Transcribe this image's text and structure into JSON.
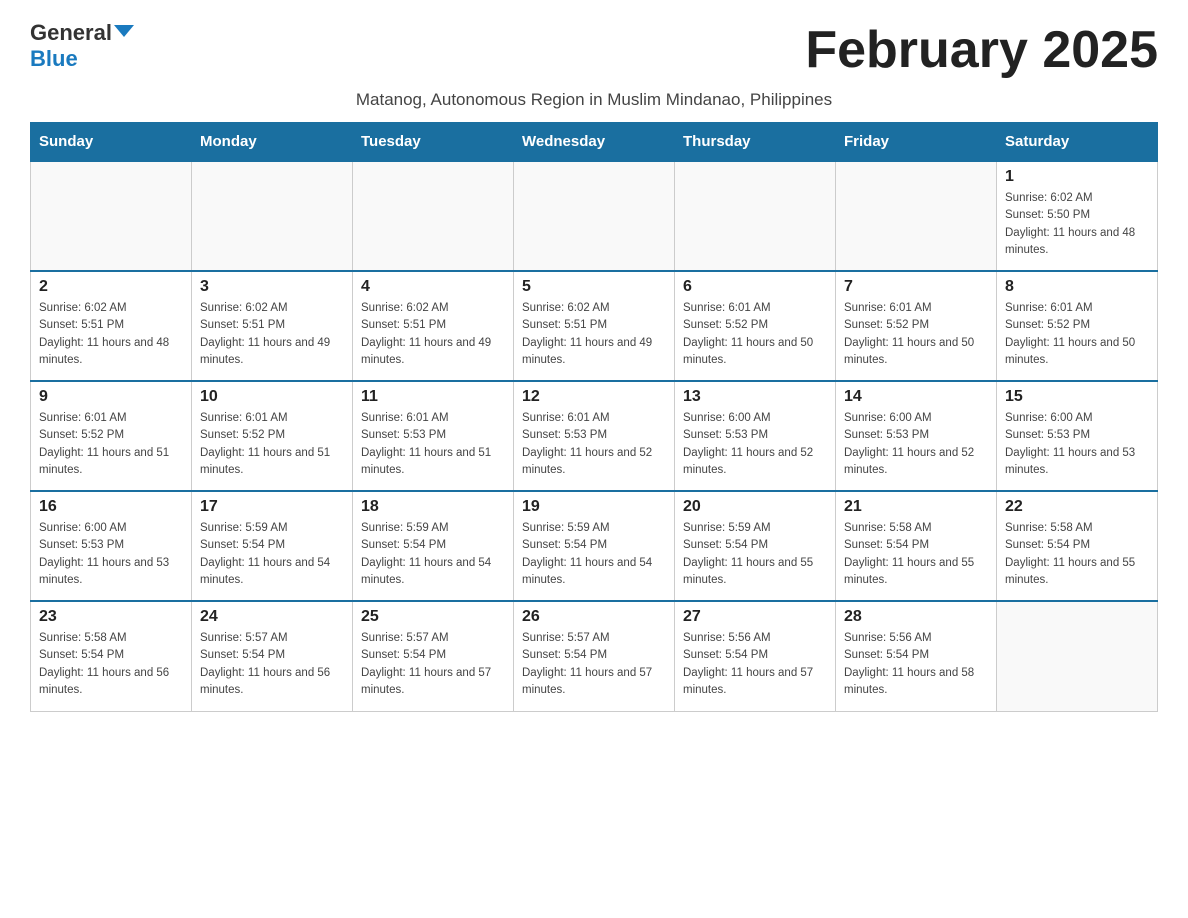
{
  "header": {
    "logo_general": "General",
    "logo_blue": "Blue",
    "month_title": "February 2025",
    "subtitle": "Matanog, Autonomous Region in Muslim Mindanao, Philippines"
  },
  "weekdays": [
    "Sunday",
    "Monday",
    "Tuesday",
    "Wednesday",
    "Thursday",
    "Friday",
    "Saturday"
  ],
  "weeks": [
    [
      {
        "day": "",
        "sunrise": "",
        "sunset": "",
        "daylight": ""
      },
      {
        "day": "",
        "sunrise": "",
        "sunset": "",
        "daylight": ""
      },
      {
        "day": "",
        "sunrise": "",
        "sunset": "",
        "daylight": ""
      },
      {
        "day": "",
        "sunrise": "",
        "sunset": "",
        "daylight": ""
      },
      {
        "day": "",
        "sunrise": "",
        "sunset": "",
        "daylight": ""
      },
      {
        "day": "",
        "sunrise": "",
        "sunset": "",
        "daylight": ""
      },
      {
        "day": "1",
        "sunrise": "Sunrise: 6:02 AM",
        "sunset": "Sunset: 5:50 PM",
        "daylight": "Daylight: 11 hours and 48 minutes."
      }
    ],
    [
      {
        "day": "2",
        "sunrise": "Sunrise: 6:02 AM",
        "sunset": "Sunset: 5:51 PM",
        "daylight": "Daylight: 11 hours and 48 minutes."
      },
      {
        "day": "3",
        "sunrise": "Sunrise: 6:02 AM",
        "sunset": "Sunset: 5:51 PM",
        "daylight": "Daylight: 11 hours and 49 minutes."
      },
      {
        "day": "4",
        "sunrise": "Sunrise: 6:02 AM",
        "sunset": "Sunset: 5:51 PM",
        "daylight": "Daylight: 11 hours and 49 minutes."
      },
      {
        "day": "5",
        "sunrise": "Sunrise: 6:02 AM",
        "sunset": "Sunset: 5:51 PM",
        "daylight": "Daylight: 11 hours and 49 minutes."
      },
      {
        "day": "6",
        "sunrise": "Sunrise: 6:01 AM",
        "sunset": "Sunset: 5:52 PM",
        "daylight": "Daylight: 11 hours and 50 minutes."
      },
      {
        "day": "7",
        "sunrise": "Sunrise: 6:01 AM",
        "sunset": "Sunset: 5:52 PM",
        "daylight": "Daylight: 11 hours and 50 minutes."
      },
      {
        "day": "8",
        "sunrise": "Sunrise: 6:01 AM",
        "sunset": "Sunset: 5:52 PM",
        "daylight": "Daylight: 11 hours and 50 minutes."
      }
    ],
    [
      {
        "day": "9",
        "sunrise": "Sunrise: 6:01 AM",
        "sunset": "Sunset: 5:52 PM",
        "daylight": "Daylight: 11 hours and 51 minutes."
      },
      {
        "day": "10",
        "sunrise": "Sunrise: 6:01 AM",
        "sunset": "Sunset: 5:52 PM",
        "daylight": "Daylight: 11 hours and 51 minutes."
      },
      {
        "day": "11",
        "sunrise": "Sunrise: 6:01 AM",
        "sunset": "Sunset: 5:53 PM",
        "daylight": "Daylight: 11 hours and 51 minutes."
      },
      {
        "day": "12",
        "sunrise": "Sunrise: 6:01 AM",
        "sunset": "Sunset: 5:53 PM",
        "daylight": "Daylight: 11 hours and 52 minutes."
      },
      {
        "day": "13",
        "sunrise": "Sunrise: 6:00 AM",
        "sunset": "Sunset: 5:53 PM",
        "daylight": "Daylight: 11 hours and 52 minutes."
      },
      {
        "day": "14",
        "sunrise": "Sunrise: 6:00 AM",
        "sunset": "Sunset: 5:53 PM",
        "daylight": "Daylight: 11 hours and 52 minutes."
      },
      {
        "day": "15",
        "sunrise": "Sunrise: 6:00 AM",
        "sunset": "Sunset: 5:53 PM",
        "daylight": "Daylight: 11 hours and 53 minutes."
      }
    ],
    [
      {
        "day": "16",
        "sunrise": "Sunrise: 6:00 AM",
        "sunset": "Sunset: 5:53 PM",
        "daylight": "Daylight: 11 hours and 53 minutes."
      },
      {
        "day": "17",
        "sunrise": "Sunrise: 5:59 AM",
        "sunset": "Sunset: 5:54 PM",
        "daylight": "Daylight: 11 hours and 54 minutes."
      },
      {
        "day": "18",
        "sunrise": "Sunrise: 5:59 AM",
        "sunset": "Sunset: 5:54 PM",
        "daylight": "Daylight: 11 hours and 54 minutes."
      },
      {
        "day": "19",
        "sunrise": "Sunrise: 5:59 AM",
        "sunset": "Sunset: 5:54 PM",
        "daylight": "Daylight: 11 hours and 54 minutes."
      },
      {
        "day": "20",
        "sunrise": "Sunrise: 5:59 AM",
        "sunset": "Sunset: 5:54 PM",
        "daylight": "Daylight: 11 hours and 55 minutes."
      },
      {
        "day": "21",
        "sunrise": "Sunrise: 5:58 AM",
        "sunset": "Sunset: 5:54 PM",
        "daylight": "Daylight: 11 hours and 55 minutes."
      },
      {
        "day": "22",
        "sunrise": "Sunrise: 5:58 AM",
        "sunset": "Sunset: 5:54 PM",
        "daylight": "Daylight: 11 hours and 55 minutes."
      }
    ],
    [
      {
        "day": "23",
        "sunrise": "Sunrise: 5:58 AM",
        "sunset": "Sunset: 5:54 PM",
        "daylight": "Daylight: 11 hours and 56 minutes."
      },
      {
        "day": "24",
        "sunrise": "Sunrise: 5:57 AM",
        "sunset": "Sunset: 5:54 PM",
        "daylight": "Daylight: 11 hours and 56 minutes."
      },
      {
        "day": "25",
        "sunrise": "Sunrise: 5:57 AM",
        "sunset": "Sunset: 5:54 PM",
        "daylight": "Daylight: 11 hours and 57 minutes."
      },
      {
        "day": "26",
        "sunrise": "Sunrise: 5:57 AM",
        "sunset": "Sunset: 5:54 PM",
        "daylight": "Daylight: 11 hours and 57 minutes."
      },
      {
        "day": "27",
        "sunrise": "Sunrise: 5:56 AM",
        "sunset": "Sunset: 5:54 PM",
        "daylight": "Daylight: 11 hours and 57 minutes."
      },
      {
        "day": "28",
        "sunrise": "Sunrise: 5:56 AM",
        "sunset": "Sunset: 5:54 PM",
        "daylight": "Daylight: 11 hours and 58 minutes."
      },
      {
        "day": "",
        "sunrise": "",
        "sunset": "",
        "daylight": ""
      }
    ]
  ]
}
